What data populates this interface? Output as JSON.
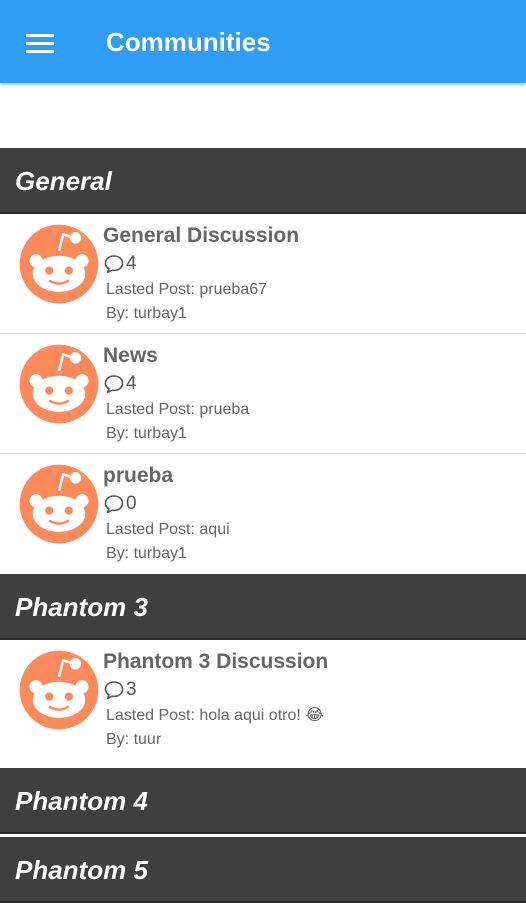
{
  "appbar": {
    "title": "Communities",
    "menu_icon": "hamburger-menu-icon",
    "color": "#2f9df4"
  },
  "sections": [
    {
      "title": "General",
      "forums": [
        {
          "name": "General Discussion",
          "comments": "4",
          "last_post_label": "Lasted Post:",
          "last_post": "prueba67",
          "by_label": "By:",
          "by": "turbay1"
        },
        {
          "name": "News",
          "comments": "4",
          "last_post_label": "Lasted Post:",
          "last_post": "prueba",
          "by_label": "By:",
          "by": "turbay1"
        },
        {
          "name": "prueba",
          "comments": "0",
          "last_post_label": "Lasted Post:",
          "last_post": "aqui",
          "by_label": "By:",
          "by": "turbay1"
        }
      ]
    },
    {
      "title": "Phantom 3",
      "forums": [
        {
          "name": "Phantom 3 Discussion",
          "comments": "3",
          "last_post_label": "Lasted Post:",
          "last_post": "hola aqui otro! 😂",
          "by_label": "By:",
          "by": "tuur"
        }
      ]
    },
    {
      "title": "Phantom 4",
      "forums": []
    },
    {
      "title": "Phantom 5",
      "forums": []
    }
  ],
  "icons": {
    "avatar": "reddit-alien-avatar-icon",
    "comment": "speech-bubble-icon"
  },
  "colors": {
    "section_header": "#3f3f3f",
    "avatar": "#fe8a5b"
  }
}
